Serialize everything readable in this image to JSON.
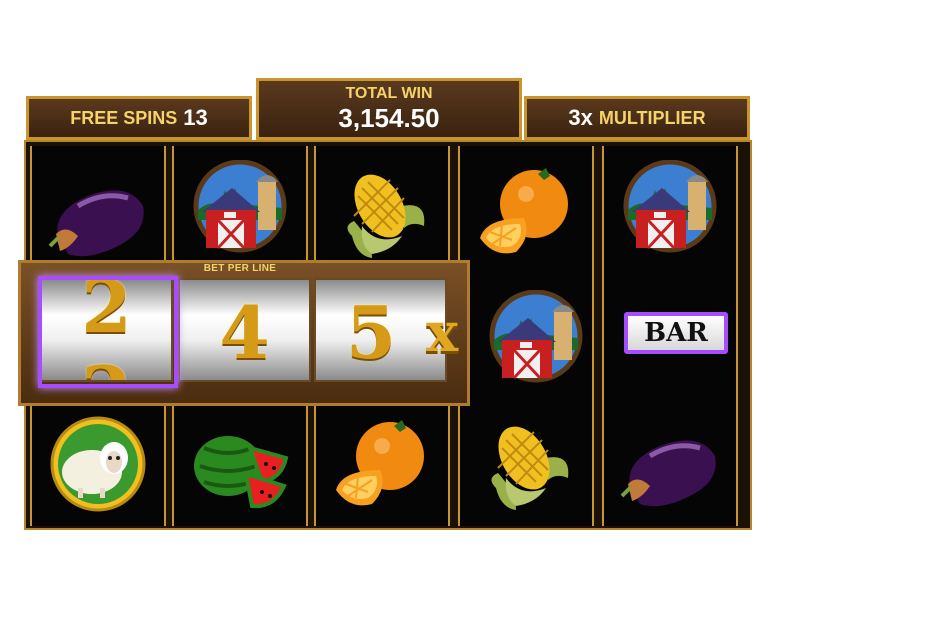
{
  "header": {
    "free_spins_label": "FREE SPINS",
    "free_spins_value": "13",
    "total_win_label": "TOTAL WIN",
    "total_win_value": "3,154.50",
    "multiplier_value": "3x",
    "multiplier_label": "MULTIPLIER"
  },
  "bet_panel": {
    "label": "BET PER LINE",
    "digits": [
      "2",
      "4",
      "5"
    ],
    "partial_digit_above": "2",
    "multiplier_suffix": "x"
  },
  "reels": [
    [
      "eggplant-icon",
      "hidden",
      "sheep-icon"
    ],
    [
      "barn-icon",
      "hidden",
      "watermelon-icon"
    ],
    [
      "corn-icon",
      "hidden",
      "orange-icon"
    ],
    [
      "orange-icon",
      "barn-icon",
      "corn-icon"
    ],
    [
      "barn-icon",
      "bar-symbol",
      "eggplant-icon"
    ]
  ],
  "bar_symbol_text": "BAR",
  "colors": {
    "frame_gold": "#c8962d",
    "panel_brown": "#4a2c10",
    "label_gold": "#f5d36a",
    "highlight_purple": "#a64dff"
  }
}
